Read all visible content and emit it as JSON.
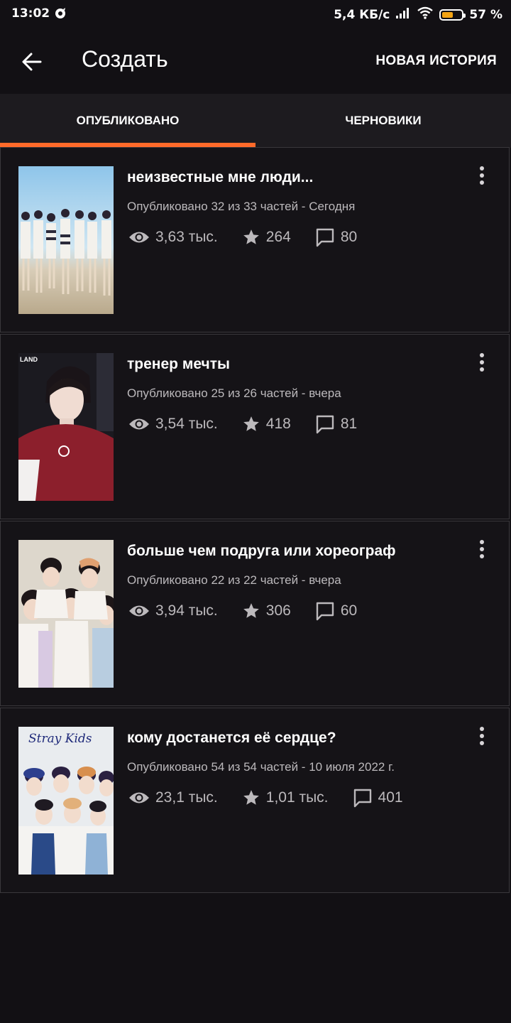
{
  "status_bar": {
    "time": "13:02",
    "network_speed": "5,4 КБ/с",
    "battery_percent": "57 %",
    "battery_level": 0.57,
    "icons": [
      "notification-icon",
      "signal-icon",
      "wifi-icon",
      "battery-icon"
    ]
  },
  "header": {
    "title": "Создать",
    "action_label": "НОВАЯ ИСТОРИЯ"
  },
  "tabs": [
    {
      "label": "ОПУБЛИКОВАНО",
      "active": true
    },
    {
      "label": "ЧЕРНОВИКИ",
      "active": false
    }
  ],
  "colors": {
    "accent": "#ff6a2a",
    "background": "#121014",
    "card": "#151317",
    "muted_text": "#bcb9bc"
  },
  "stories": [
    {
      "title": "неизвестные мне люди...",
      "meta": "Опубликовано 32 из 33 частей - Сегодня",
      "views": "3,63 тыс.",
      "votes": "264",
      "comments": "80"
    },
    {
      "title": "тренер мечты",
      "meta": "Опубликовано 25 из 26 частей - вчера",
      "views": "3,54 тыс.",
      "votes": "418",
      "comments": "81"
    },
    {
      "title": "больше чем подруга или хореограф",
      "meta": "Опубликовано 22 из 22 частей - вчера",
      "views": "3,94 тыс.",
      "votes": "306",
      "comments": "60"
    },
    {
      "title": "кому достанется её сердце?",
      "meta": "Опубликовано 54 из 54 частей - 10 июля 2022 г.",
      "views": "23,1 тыс.",
      "votes": "1,01 тыс.",
      "comments": "401",
      "cover_text": "Stray Kids"
    }
  ]
}
